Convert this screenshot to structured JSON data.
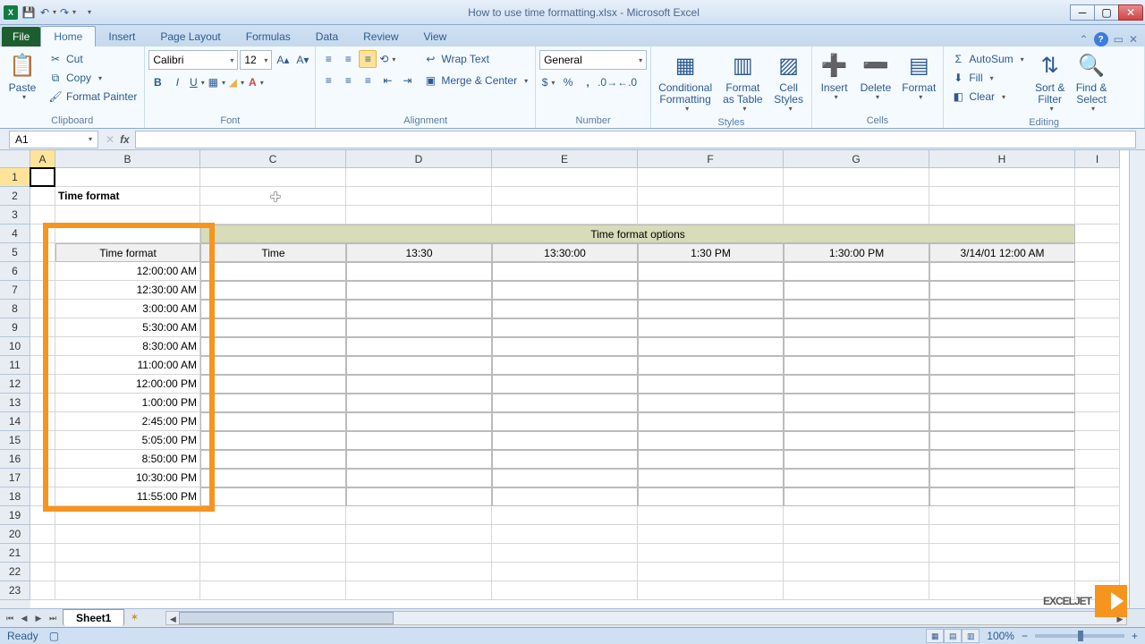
{
  "window": {
    "title": "How to use time formatting.xlsx - Microsoft Excel"
  },
  "tabs": {
    "file": "File",
    "home": "Home",
    "insert": "Insert",
    "pageLayout": "Page Layout",
    "formulas": "Formulas",
    "data": "Data",
    "review": "Review",
    "view": "View"
  },
  "ribbon": {
    "clipboard": {
      "label": "Clipboard",
      "paste": "Paste",
      "cut": "Cut",
      "copy": "Copy",
      "formatPainter": "Format Painter"
    },
    "font": {
      "label": "Font",
      "family": "Calibri",
      "size": "12"
    },
    "alignment": {
      "label": "Alignment",
      "wrap": "Wrap Text",
      "merge": "Merge & Center"
    },
    "number": {
      "label": "Number",
      "format": "General"
    },
    "styles": {
      "label": "Styles",
      "conditional": "Conditional\nFormatting",
      "formatTable": "Format\nas Table",
      "cellStyles": "Cell\nStyles"
    },
    "cells": {
      "label": "Cells",
      "insert": "Insert",
      "delete": "Delete",
      "format": "Format"
    },
    "editing": {
      "label": "Editing",
      "autosum": "AutoSum",
      "fill": "Fill",
      "clear": "Clear",
      "sort": "Sort &\nFilter",
      "find": "Find &\nSelect"
    }
  },
  "nameBox": "A1",
  "columns": [
    "A",
    "B",
    "C",
    "D",
    "E",
    "F",
    "G",
    "H",
    "I"
  ],
  "colWidths": {
    "A": 28,
    "B": 162,
    "C": 163,
    "D": 163,
    "E": 163,
    "F": 163,
    "G": 163,
    "H": 163,
    "I": 50
  },
  "rowCount": 23,
  "sheet": {
    "titleCell": "Time format",
    "mergedHeader": "Time format options",
    "headerB": "Time format",
    "headerC": "Time",
    "headerD": "13:30",
    "headerE": "13:30:00",
    "headerF": "1:30 PM",
    "headerG": "1:30:00 PM",
    "headerH": "3/14/01 12:00 AM",
    "values": [
      "12:00:00 AM",
      "12:30:00 AM",
      "3:00:00 AM",
      "5:30:00 AM",
      "8:30:00 AM",
      "11:00:00 AM",
      "12:00:00 PM",
      "1:00:00 PM",
      "2:45:00 PM",
      "5:05:00 PM",
      "8:50:00 PM",
      "10:30:00 PM",
      "11:55:00 PM"
    ]
  },
  "sheetTab": "Sheet1",
  "status": {
    "ready": "Ready",
    "zoom": "100%"
  },
  "watermark": "EXCELJET"
}
